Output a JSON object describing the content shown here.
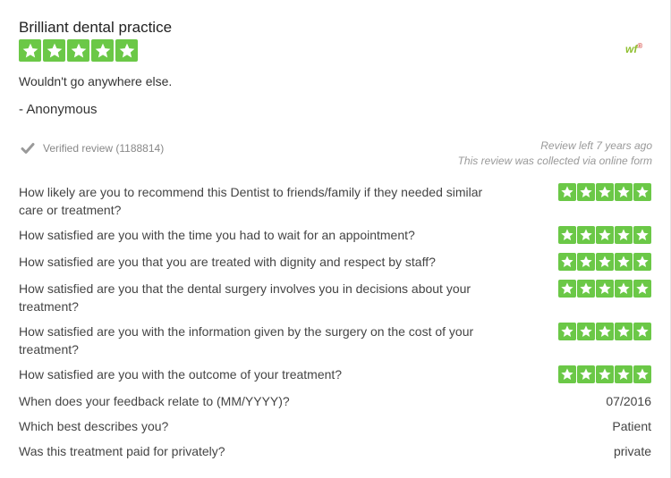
{
  "review": {
    "title": "Brilliant dental practice",
    "rating": 5,
    "body": "Wouldn't go anywhere else.",
    "author": "- Anonymous",
    "logo_text": "wf",
    "logo_sup": "®",
    "verified_label": "Verified review (1188814)",
    "review_age": "Review left 7 years ago",
    "collection_method": "This review was collected via online form"
  },
  "questions": [
    {
      "text": "How likely are you to recommend this Dentist to friends/family if they needed similar care or treatment?",
      "rating": 5
    },
    {
      "text": "How satisfied are you with the time you had to wait for an appointment?",
      "rating": 5
    },
    {
      "text": "How satisfied are you that you are treated with dignity and respect by staff?",
      "rating": 5
    },
    {
      "text": "How satisfied are you that the dental surgery involves you in decisions about your treatment?",
      "rating": 5
    },
    {
      "text": "How satisfied are you with the information given by the surgery on the cost of your treatment?",
      "rating": 5
    },
    {
      "text": "How satisfied are you with the outcome of your treatment?",
      "rating": 5
    },
    {
      "text": "When does your feedback relate to (MM/YYYY)?",
      "answer": "07/2016"
    },
    {
      "text": "Which best describes you?",
      "answer": "Patient"
    },
    {
      "text": "Was this treatment paid for privately?",
      "answer": "private"
    }
  ],
  "colors": {
    "star_green": "#6bc847",
    "logo_green": "#8fbf2f"
  },
  "icons": {
    "star": "star-icon",
    "check": "check-icon"
  }
}
